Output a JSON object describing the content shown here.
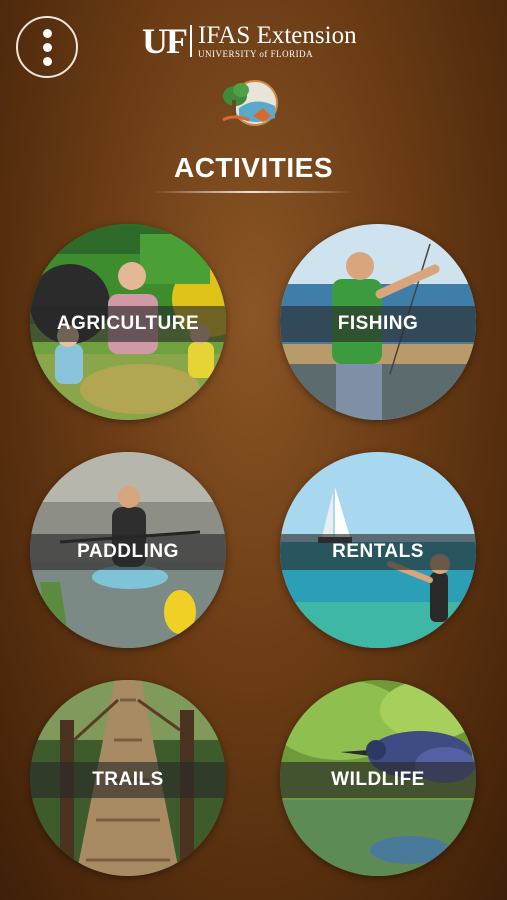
{
  "header": {
    "brand_mark": "UF",
    "brand_title": "IFAS Extension",
    "brand_subtitle": "UNIVERSITY of FLORIDA"
  },
  "page_title": "ACTIVITIES",
  "activities": [
    {
      "label": "AGRICULTURE"
    },
    {
      "label": "FISHING"
    },
    {
      "label": "PADDLING"
    },
    {
      "label": "RENTALS"
    },
    {
      "label": "TRAILS"
    },
    {
      "label": "WILDLIFE"
    }
  ]
}
